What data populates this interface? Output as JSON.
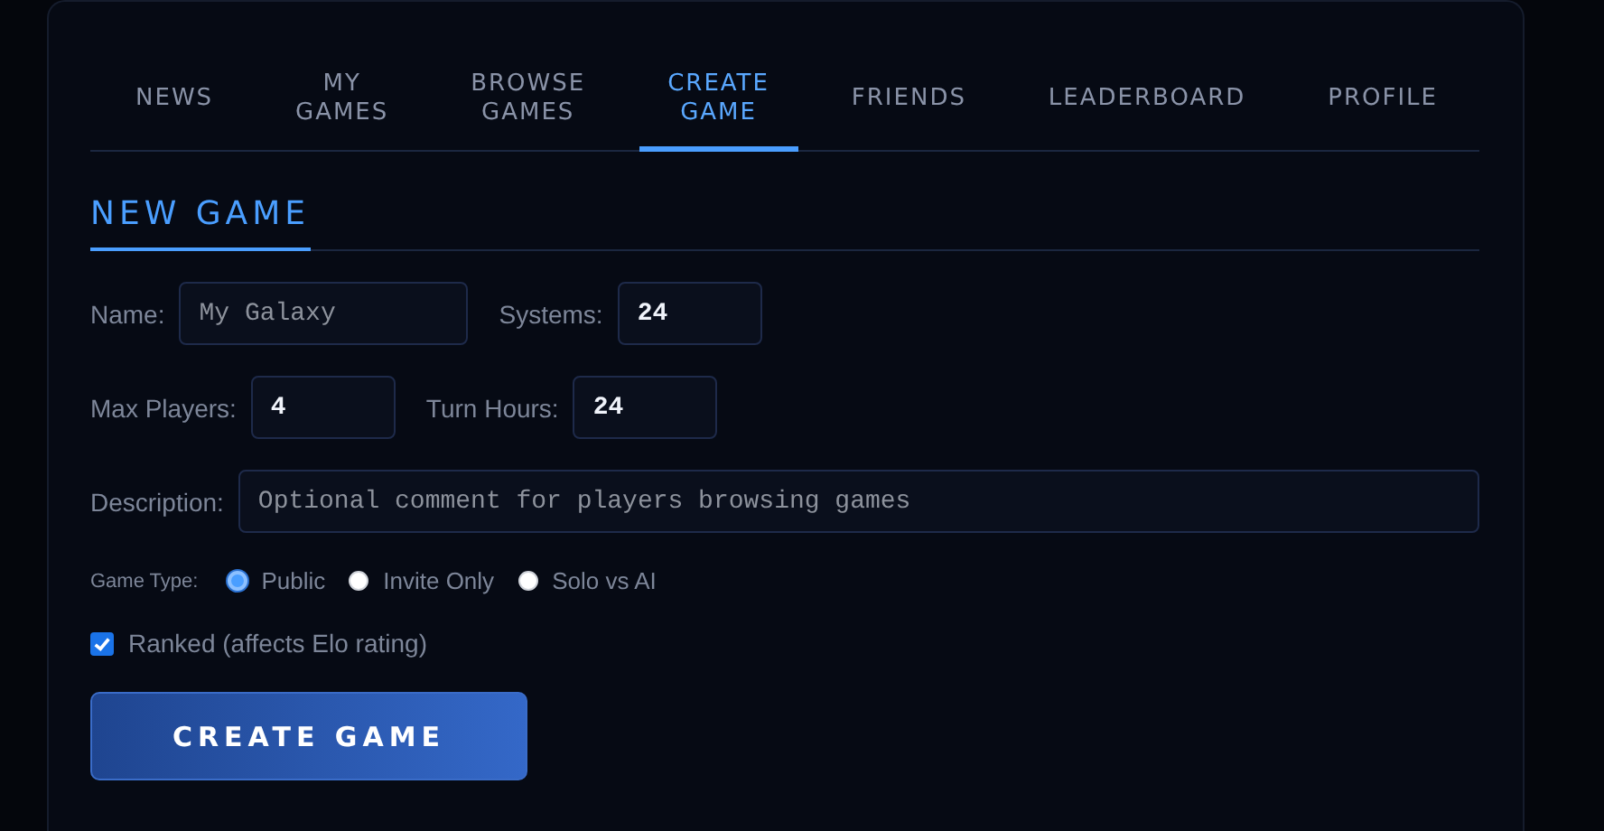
{
  "tabs": [
    {
      "label": "NEWS",
      "selected": false
    },
    {
      "label": "MY GAMES",
      "selected": false
    },
    {
      "label": "BROWSE GAMES",
      "selected": false
    },
    {
      "label": "CREATE GAME",
      "selected": true
    },
    {
      "label": "FRIENDS",
      "selected": false
    },
    {
      "label": "LEADERBOARD",
      "selected": false
    },
    {
      "label": "PROFILE",
      "selected": false
    }
  ],
  "form": {
    "title": "NEW GAME",
    "rows": [
      [
        {
          "kind": "text",
          "label": "Name:",
          "placeholder": "My Galaxy"
        },
        {
          "kind": "number",
          "label": "Systems:",
          "value": "24"
        }
      ],
      [
        {
          "kind": "number",
          "label": "Max Players:",
          "value": "4"
        },
        {
          "kind": "number",
          "label": "Turn Hours:",
          "value": "24"
        }
      ],
      [
        {
          "kind": "long",
          "label": "Description:",
          "placeholder": "Optional comment for players browsing games"
        }
      ]
    ],
    "game_type": {
      "label": "Game Type:",
      "options": [
        {
          "label": "Public",
          "selected": true
        },
        {
          "label": "Invite Only",
          "selected": false
        },
        {
          "label": "Solo vs AI",
          "selected": false
        }
      ]
    },
    "ranked": {
      "label": "Ranked (affects Elo rating)",
      "checked": true
    },
    "submit": "CREATE GAME"
  }
}
